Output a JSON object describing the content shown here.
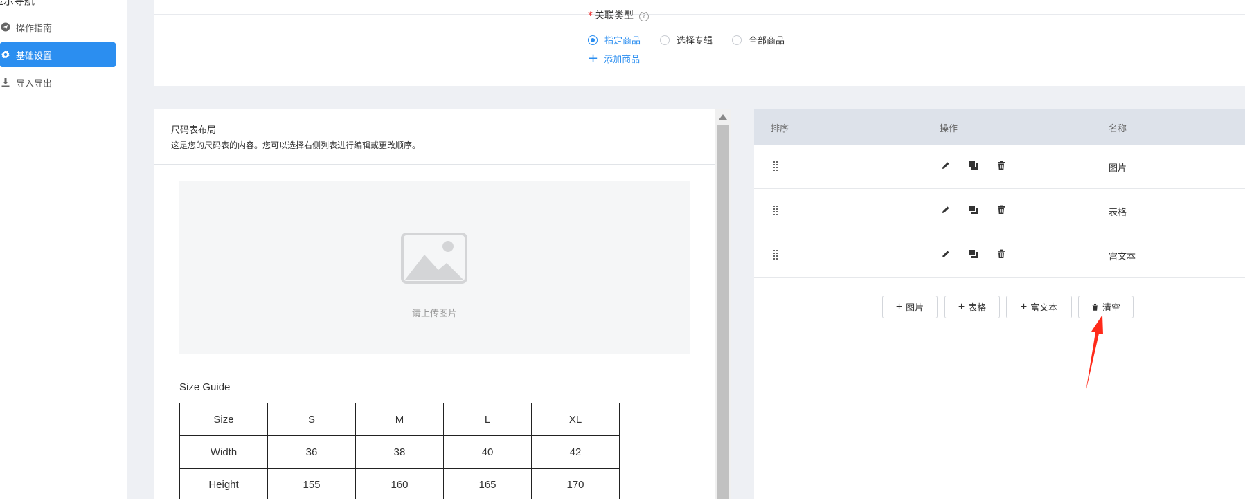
{
  "sidebar": {
    "top_label": "显示导航",
    "items": [
      {
        "label": "操作指南",
        "icon": "send-icon"
      },
      {
        "label": "基础设置",
        "icon": "gear-icon",
        "active": true
      },
      {
        "label": "导入导出",
        "icon": "download-icon"
      }
    ]
  },
  "relation": {
    "label": "关联类型",
    "options": [
      {
        "label": "指定商品",
        "checked": true
      },
      {
        "label": "选择专辑",
        "checked": false
      },
      {
        "label": "全部商品",
        "checked": false
      }
    ],
    "add_label": "添加商品"
  },
  "preview": {
    "title": "尺码表布局",
    "description": "这是您的尺码表的内容。您可以选择右侧列表进行编辑或更改顺序。",
    "upload_text": "请上传图片",
    "size_guide_title": "Size Guide",
    "table": [
      [
        "Size",
        "S",
        "M",
        "L",
        "XL"
      ],
      [
        "Width",
        "36",
        "38",
        "40",
        "42"
      ],
      [
        "Height",
        "155",
        "160",
        "165",
        "170"
      ]
    ]
  },
  "list": {
    "headers": {
      "sort": "排序",
      "actions": "操作",
      "name": "名称"
    },
    "rows": [
      {
        "name": "图片"
      },
      {
        "name": "表格"
      },
      {
        "name": "富文本"
      }
    ],
    "buttons": {
      "image": "图片",
      "table": "表格",
      "richtext": "富文本",
      "clear": "清空"
    }
  },
  "colors": {
    "accent": "#2b8ef0",
    "annotation_arrow": "#ff2a1a"
  }
}
